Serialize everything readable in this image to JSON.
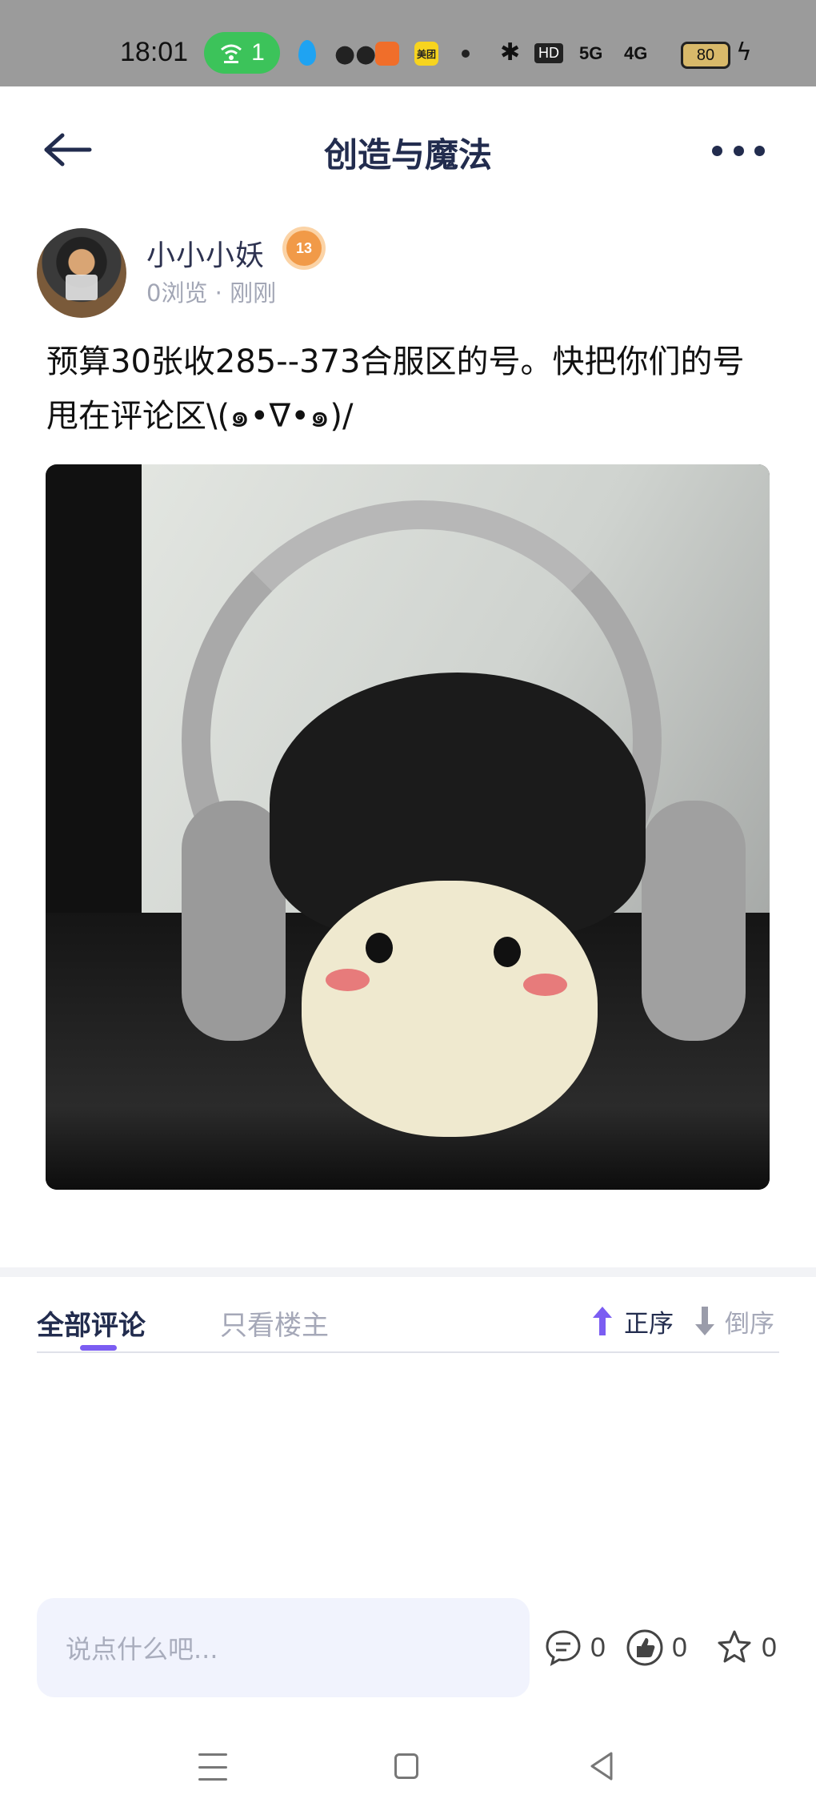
{
  "status_bar": {
    "time": "18:01",
    "wifi_count": "1",
    "app_meituan": "美团",
    "network_1": "5G",
    "network_2": "4G",
    "hd_label": "HD",
    "battery": "80"
  },
  "header": {
    "title": "创造与魔法",
    "back_icon": "arrow-left-icon",
    "more_icon": "more-dots-icon"
  },
  "post": {
    "author_name": "小小小妖",
    "level": "13",
    "meta": "0浏览 · 刚刚",
    "text": "预算30张收285--373合服区的号。快把你们的号甩在评论区\\(๑•ᐁ•๑)/",
    "image_description": "plush-with-headphones-image"
  },
  "comments": {
    "tab_all": "全部评论",
    "tab_owner": "只看楼主",
    "sort_asc": "正序",
    "sort_desc": "倒序",
    "accent_color": "#7b5df2"
  },
  "action_bar": {
    "input_placeholder": "说点什么吧...",
    "comment_count": "0",
    "like_count": "0",
    "favorite_count": "0"
  }
}
